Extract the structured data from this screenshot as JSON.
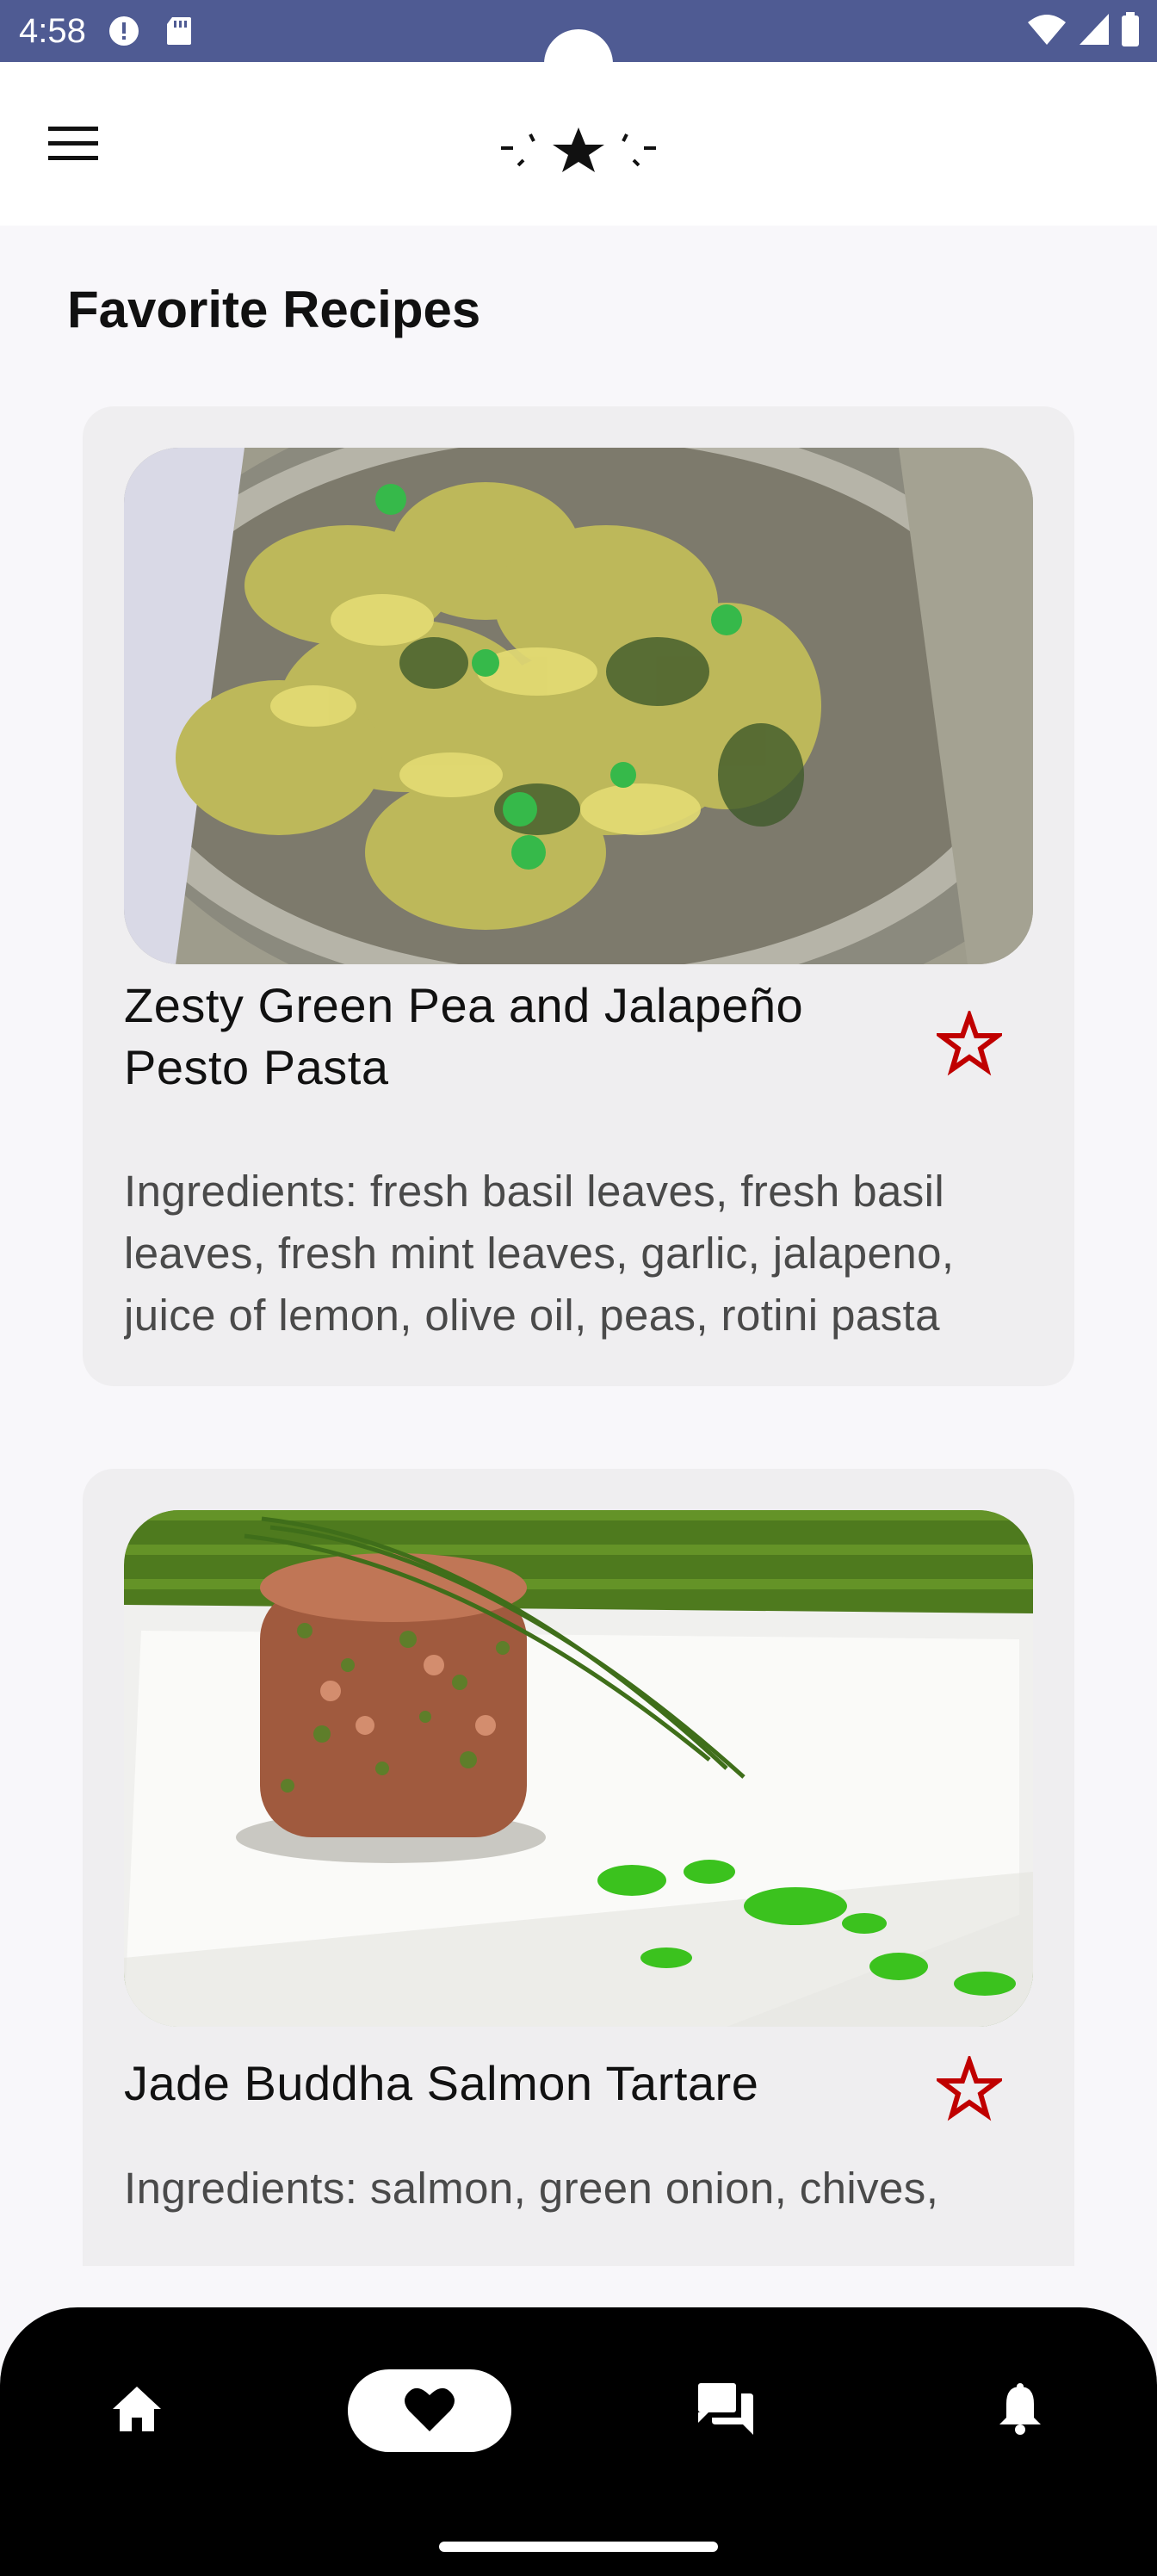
{
  "status_bar": {
    "time": "4:58",
    "left_icons": [
      "alert-circle-icon",
      "sd-card-icon"
    ],
    "right_icons": [
      "wifi-icon",
      "signal-icon",
      "battery-icon"
    ],
    "color": "#4F5B93"
  },
  "app_bar": {
    "menu_icon": "hamburger-menu-icon",
    "logo_icon": "sparkle-star-logo-icon"
  },
  "page": {
    "title": "Favorite Recipes"
  },
  "recipes": [
    {
      "title": "Zesty Green Pea and Jalapeño Pesto Pasta",
      "ingredients": "Ingredients: fresh basil leaves, fresh basil leaves, fresh mint leaves, garlic, jalapeno, juice of lemon, olive oil, peas, rotini pasta",
      "favorite_icon": "star-outline-icon",
      "image": "pasta-photo"
    },
    {
      "title": "Jade Buddha Salmon Tartare",
      "ingredients": "Ingredients: salmon, green onion, chives,",
      "favorite_icon": "star-outline-icon",
      "image": "salmon-tartare-photo"
    }
  ],
  "bottom_nav": {
    "items": [
      {
        "icon": "home-icon",
        "active": false
      },
      {
        "icon": "heart-icon",
        "active": true
      },
      {
        "icon": "chat-icon",
        "active": false
      },
      {
        "icon": "bell-icon",
        "active": false
      }
    ]
  },
  "colors": {
    "accent_red": "#C00000",
    "background": "#F8F7FA",
    "card": "#EFEEF0",
    "nav_bg": "#000000"
  }
}
